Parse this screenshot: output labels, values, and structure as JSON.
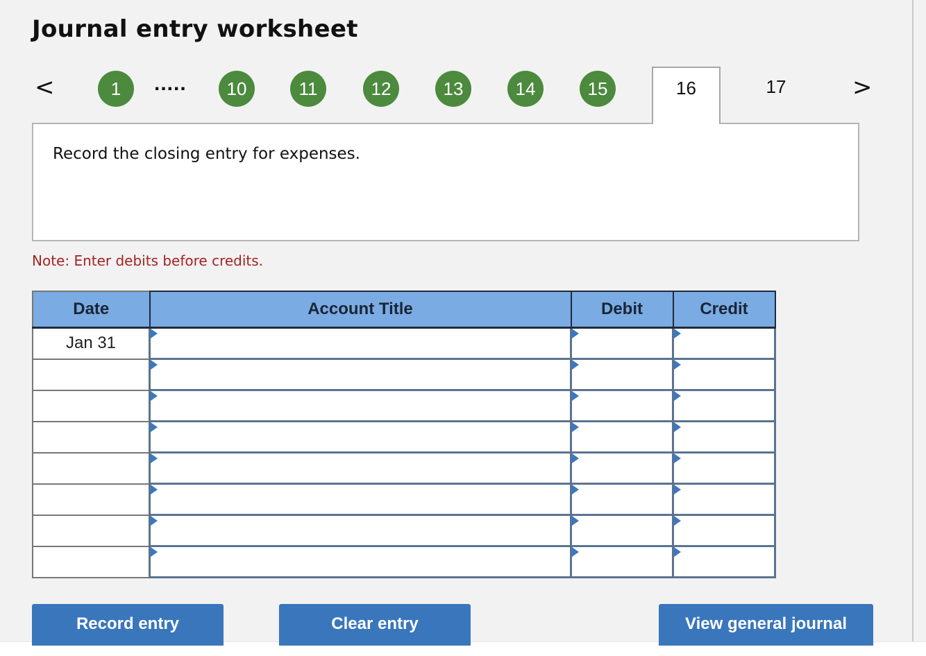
{
  "page": {
    "title": "Journal entry worksheet"
  },
  "navigation": {
    "prev_icon": "chevron-left-icon",
    "prev_glyph": "<",
    "next_icon": "chevron-right-icon",
    "next_glyph": ">",
    "ellipsis": ".....",
    "completed_steps": [
      "1",
      "10",
      "11",
      "12",
      "13",
      "14",
      "15"
    ],
    "completed_color": "#4c8a3e",
    "active_step": "16",
    "upcoming_steps": [
      "17"
    ]
  },
  "prompt": {
    "text": "Record the closing entry for expenses."
  },
  "note": {
    "text": "Note: Enter debits before credits.",
    "color": "#a52222"
  },
  "journal_table": {
    "columns": [
      "Date",
      "Account Title",
      "Debit",
      "Credit"
    ],
    "header_color": "#7aabe3",
    "rows": [
      {
        "date": "Jan 31",
        "account": "",
        "debit": "",
        "credit": ""
      },
      {
        "date": "",
        "account": "",
        "debit": "",
        "credit": ""
      },
      {
        "date": "",
        "account": "",
        "debit": "",
        "credit": ""
      },
      {
        "date": "",
        "account": "",
        "debit": "",
        "credit": ""
      },
      {
        "date": "",
        "account": "",
        "debit": "",
        "credit": ""
      },
      {
        "date": "",
        "account": "",
        "debit": "",
        "credit": ""
      },
      {
        "date": "",
        "account": "",
        "debit": "",
        "credit": ""
      },
      {
        "date": "",
        "account": "",
        "debit": "",
        "credit": ""
      }
    ]
  },
  "buttons": {
    "record": "Record entry",
    "clear": "Clear entry",
    "view": "View general journal",
    "color": "#3a76bc"
  }
}
